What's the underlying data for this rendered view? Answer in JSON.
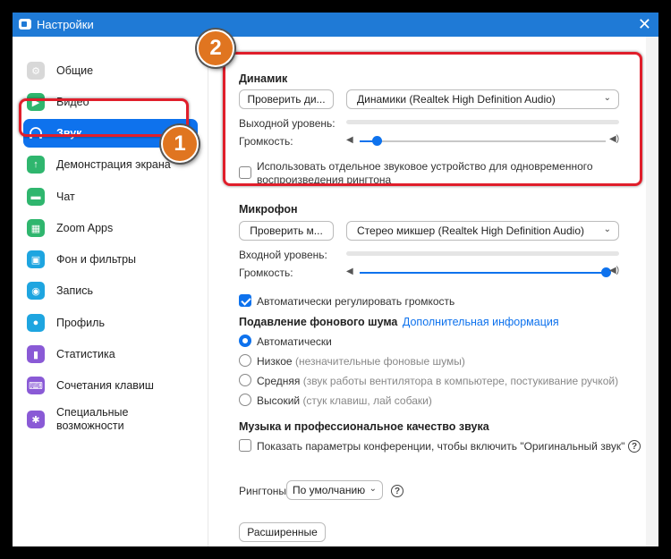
{
  "window": {
    "title": "Настройки",
    "close_glyph": "✕"
  },
  "sidebar": {
    "items": [
      {
        "label": "Общие",
        "icon": "gear-icon",
        "color": "#d8d8d8"
      },
      {
        "label": "Видео",
        "icon": "video-icon",
        "color": "#2fb66e"
      },
      {
        "label": "Звук",
        "icon": "headphones-icon",
        "color": "#0e72ed",
        "active": true
      },
      {
        "label": "Демонстрация экрана",
        "icon": "screen-share-icon",
        "color": "#2fb66e"
      },
      {
        "label": "Чат",
        "icon": "chat-icon",
        "color": "#2fb66e"
      },
      {
        "label": "Zoom Apps",
        "icon": "apps-icon",
        "color": "#2fb66e"
      },
      {
        "label": "Фон и фильтры",
        "icon": "background-icon",
        "color": "#1ea5e0"
      },
      {
        "label": "Запись",
        "icon": "record-icon",
        "color": "#1ea5e0"
      },
      {
        "label": "Профиль",
        "icon": "profile-icon",
        "color": "#1ea5e0"
      },
      {
        "label": "Статистика",
        "icon": "statistics-icon",
        "color": "#8a5ad6"
      },
      {
        "label": "Сочетания клавиш",
        "icon": "keyboard-icon",
        "color": "#8a5ad6"
      },
      {
        "label": "Специальные возможности",
        "icon": "accessibility-icon",
        "color": "#8a5ad6"
      }
    ]
  },
  "annotations": {
    "badge1": "1",
    "badge2": "2",
    "color": "#e01e2b",
    "badge_color": "#e07520"
  },
  "speaker": {
    "title": "Динамик",
    "test_button": "Проверить ди...",
    "device": "Динамики (Realtek High Definition Audio)",
    "output_level_label": "Выходной уровень:",
    "volume_label": "Громкость:",
    "volume": 0.07,
    "separate_device_label": "Использовать отдельное звуковое устройство для одновременного воспроизведения рингтона",
    "separate_device_checked": false
  },
  "microphone": {
    "title": "Микрофон",
    "test_button": "Проверить м...",
    "device": "Стерео микшер (Realtek High Definition Audio)",
    "input_level_label": "Входной уровень:",
    "volume_label": "Громкость:",
    "volume": 1.0,
    "auto_adjust_label": "Автоматически регулировать громкость",
    "auto_adjust_checked": true
  },
  "noise": {
    "title": "Подавление фонового шума",
    "more_info": "Дополнительная информация",
    "options": [
      {
        "label": "Автоматически",
        "hint": "",
        "checked": true
      },
      {
        "label": "Низкое",
        "hint": "(незначительные фоновые шумы)",
        "checked": false
      },
      {
        "label": "Средняя",
        "hint": "(звук работы вентилятора в компьютере, постукивание ручкой)",
        "checked": false
      },
      {
        "label": "Высокий",
        "hint": "(стук клавиш, лай собаки)",
        "checked": false
      }
    ]
  },
  "music": {
    "title": "Музыка и профессиональное качество звука",
    "original_sound_label": "Показать параметры конференции, чтобы включить \"Оригинальный звук\"",
    "original_sound_checked": false
  },
  "ringtones": {
    "label": "Рингтоны",
    "value": "По умолчанию"
  },
  "advanced_button": "Расширенные"
}
